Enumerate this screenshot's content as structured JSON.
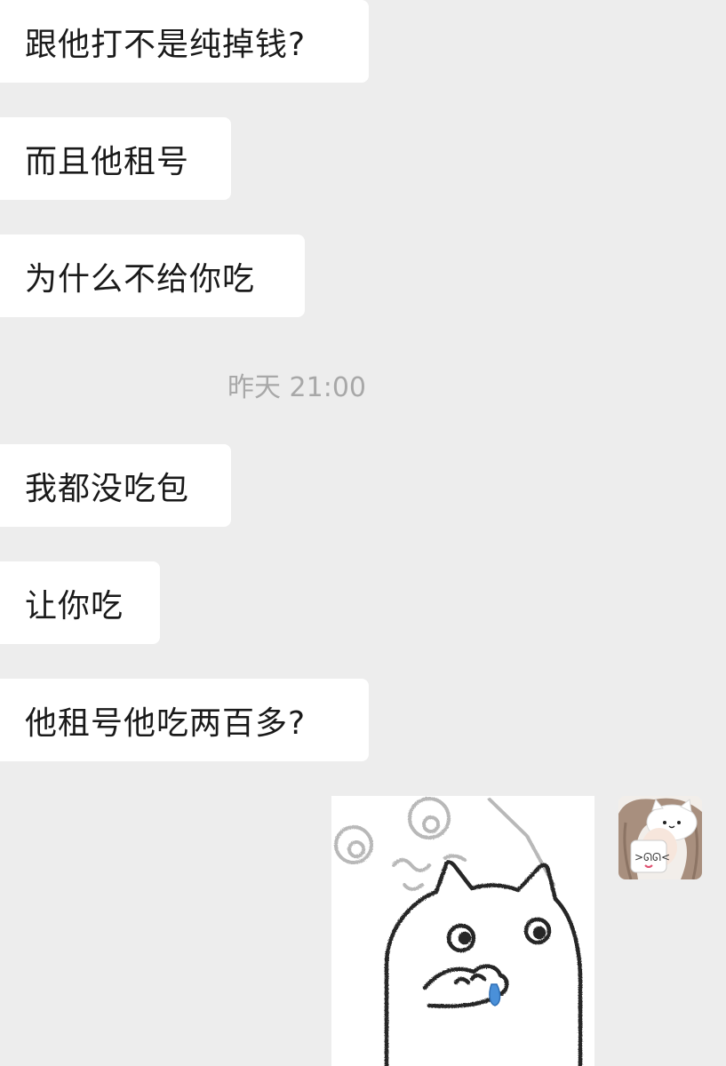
{
  "messages": [
    {
      "text": "跟他打不是纯掉钱?"
    },
    {
      "text": "而且他租号"
    },
    {
      "text": "为什么不给你吃"
    },
    {
      "text": "我都没吃包"
    },
    {
      "text": "让你吃"
    },
    {
      "text": "他租号他吃两百多?"
    }
  ],
  "timestamp": "昨天 21:00",
  "sticker": {
    "icon": "cat-doodle-sticker"
  },
  "avatar": {
    "icon": "girl-with-cat-avatar"
  },
  "colors": {
    "background": "#ededed",
    "bubble": "#ffffff",
    "text": "#1a1a1a",
    "timestamp": "#a8a8a8",
    "drop": "#4a90d9"
  }
}
